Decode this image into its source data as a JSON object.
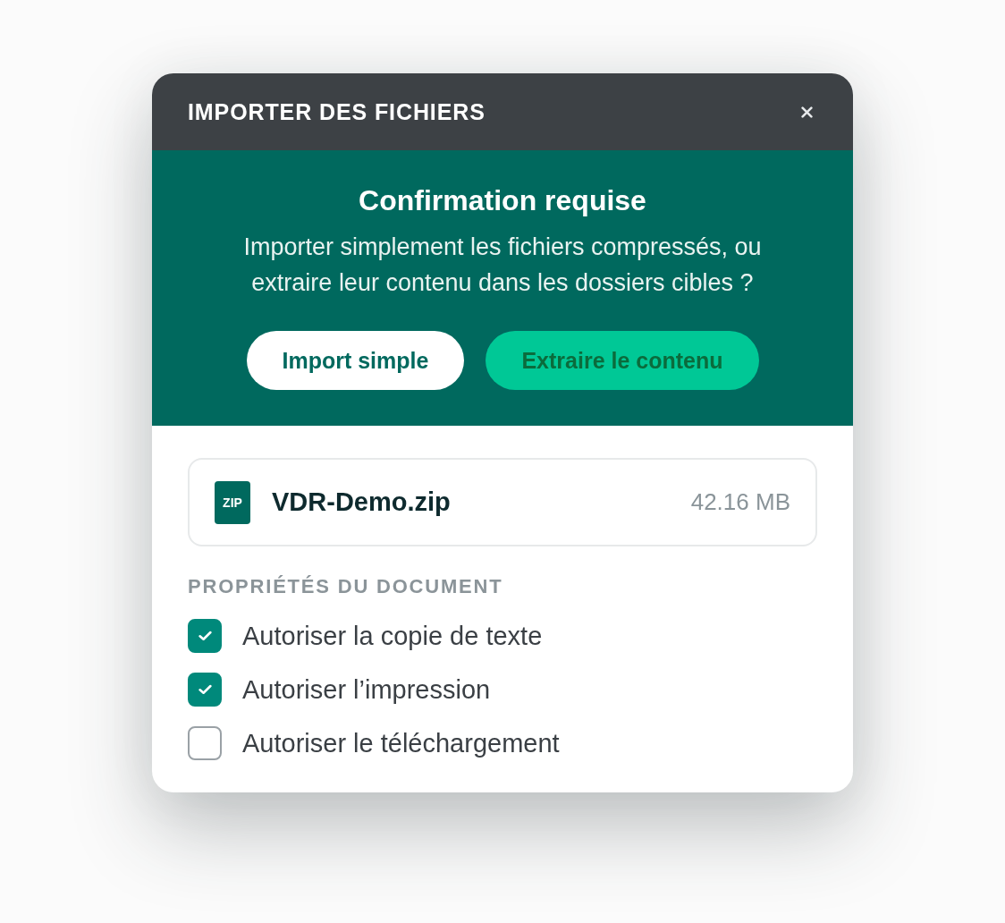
{
  "window": {
    "title": "IMPORTER DES FICHIERS"
  },
  "confirmation": {
    "heading": "Confirmation requise",
    "message": "Importer simplement les fichiers compressés, ou extraire leur contenu dans les dossiers cibles ?",
    "buttons": [
      {
        "label": "Import simple",
        "kind": "secondary"
      },
      {
        "label": "Extraire le contenu",
        "kind": "primary"
      }
    ]
  },
  "file": {
    "type": "ZIP",
    "name": "VDR-Demo.zip",
    "size": "42.16 MB"
  },
  "properties": {
    "heading": "PROPRIÉTÉS DU DOCUMENT",
    "options": [
      {
        "label": "Autoriser la copie de texte",
        "checked": true
      },
      {
        "label": "Autoriser l’impression",
        "checked": true
      },
      {
        "label": "Autoriser le téléchargement",
        "checked": false
      }
    ]
  }
}
